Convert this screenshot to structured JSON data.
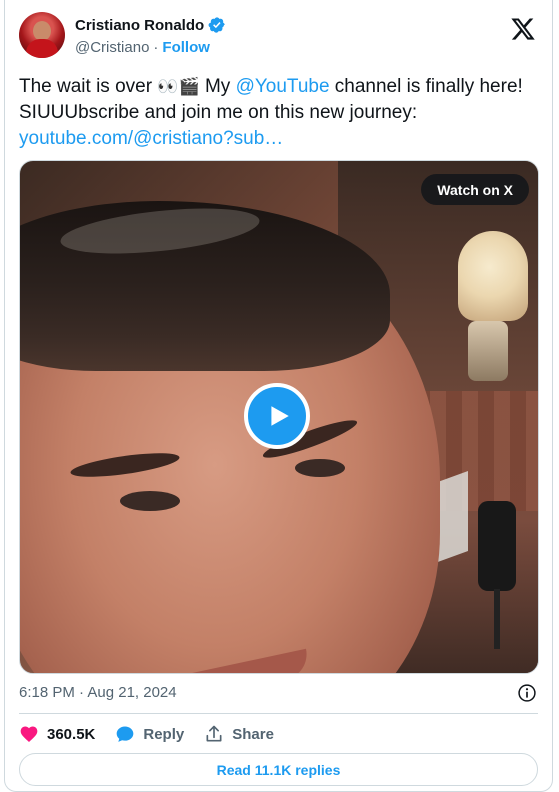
{
  "author": {
    "display_name": "Cristiano Ronaldo",
    "handle": "@Cristiano",
    "separator": "·",
    "follow_label": "Follow"
  },
  "tweet": {
    "text_1": "The wait is over ",
    "emoji_eyes": "👀",
    "emoji_clapper": "🎬",
    "text_2": " My ",
    "mention": "@YouTube",
    "text_3": " channel is finally here! SIUUUbscribe and join me on this new journey: ",
    "link": "youtube.com/@cristiano?sub…"
  },
  "media": {
    "watch_label": "Watch on X"
  },
  "meta": {
    "timestamp": "6:18 PM · Aug 21, 2024"
  },
  "actions": {
    "likes": "360.5K",
    "reply_label": "Reply",
    "share_label": "Share"
  },
  "replies_button": "Read 11.1K replies",
  "colors": {
    "accent": "#1d9bf0",
    "like": "#f91880",
    "text": "#0f1419",
    "muted": "#536471"
  }
}
